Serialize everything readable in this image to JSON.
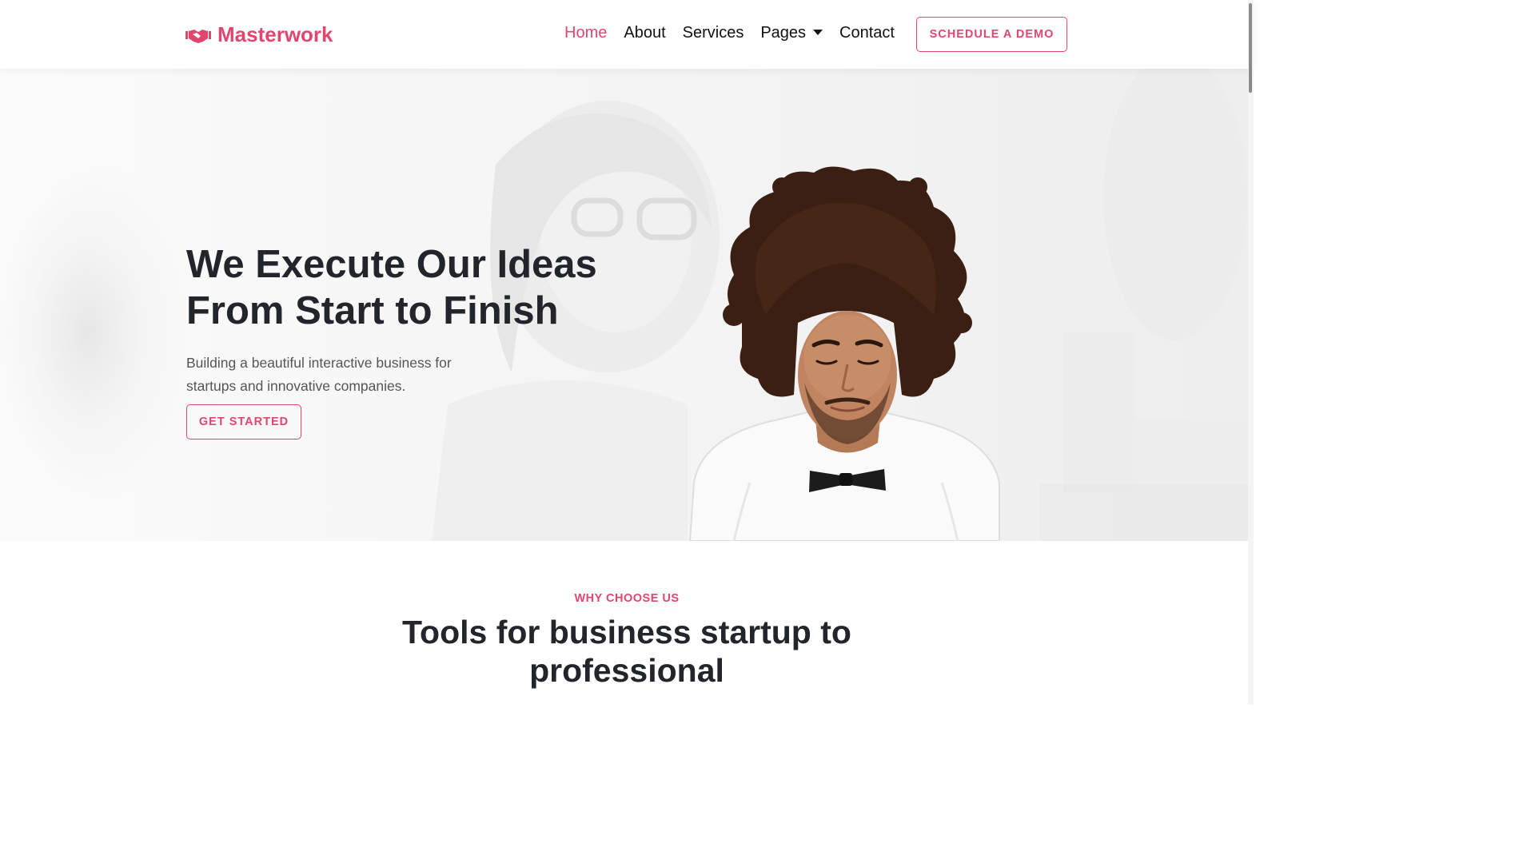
{
  "brand": {
    "name": "Masterwork",
    "icon": "handshake-icon",
    "color": "#e2466f"
  },
  "nav": {
    "items": [
      {
        "label": "Home",
        "active": true
      },
      {
        "label": "About",
        "active": false
      },
      {
        "label": "Services",
        "active": false
      },
      {
        "label": "Pages",
        "active": false,
        "dropdown": true
      },
      {
        "label": "Contact",
        "active": false
      }
    ],
    "cta_label": "Schedule a demo"
  },
  "hero": {
    "title_line1": "We Execute Our Ideas",
    "title_line2": "From Start to Finish",
    "subtitle": "Building a beautiful interactive business for startups and innovative companies.",
    "cta_label": "Get Started"
  },
  "why": {
    "kicker": "WHY CHOOSE US",
    "title": "Tools for business startup to professional"
  },
  "colors": {
    "accent": "#e2466f",
    "heading": "#22252b",
    "body_text": "#555555"
  }
}
